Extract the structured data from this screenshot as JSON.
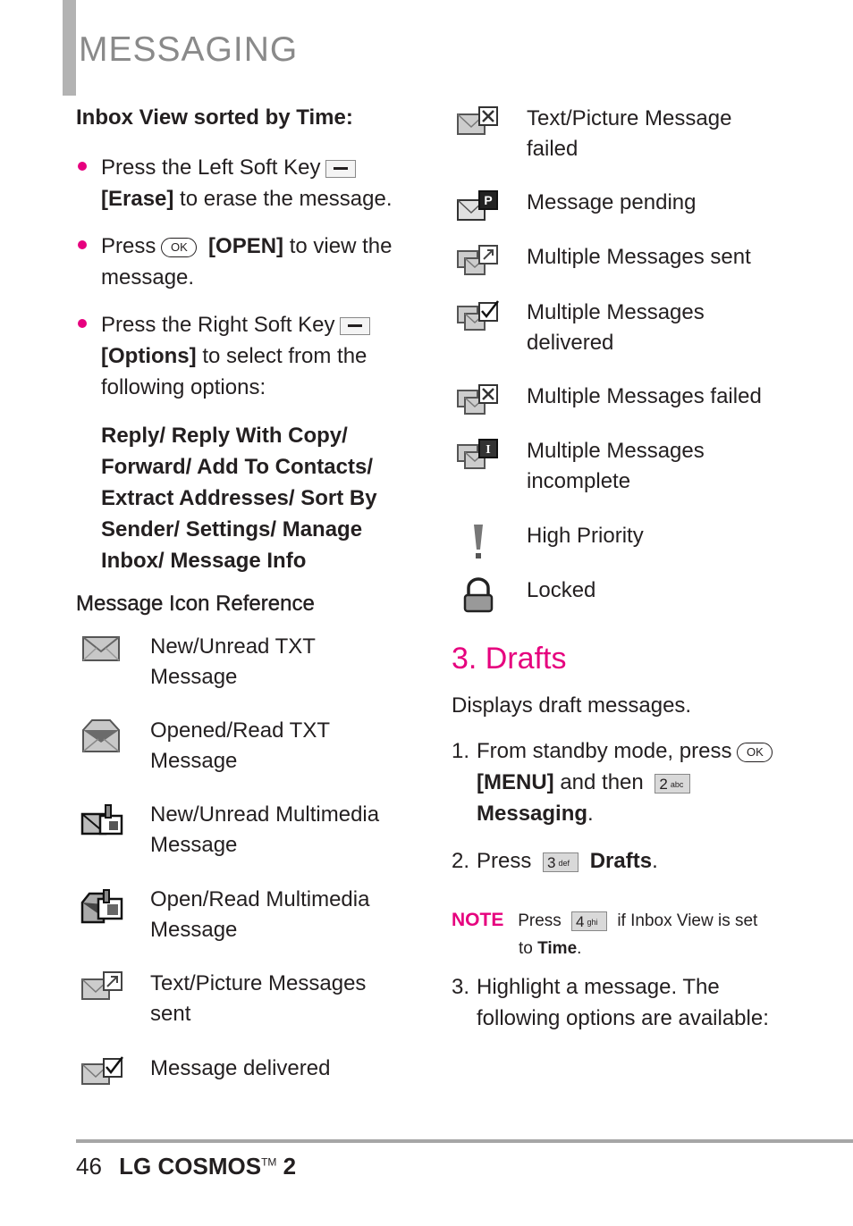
{
  "header": {
    "section_title": "MESSAGING"
  },
  "inbox_view": {
    "heading": "Inbox View sorted by Time:",
    "bullets": [
      {
        "pre": "Press the Left Soft Key",
        "key": "left-soft-key",
        "bold": "[Erase]",
        "post": "to erase the message."
      },
      {
        "pre": "Press",
        "key": "OK",
        "bold": "[OPEN]",
        "post": "to view the message."
      },
      {
        "pre": "Press the Right Soft Key",
        "key": "right-soft-key",
        "bold": "[Options]",
        "post": "to select from the following options:"
      }
    ],
    "options_text": "Reply/ Reply With Copy/ Forward/ Add To Contacts/ Extract Addresses/ Sort By Sender/ Settings/ Manage Inbox/ Message Info"
  },
  "icon_reference": {
    "heading": "Message Icon Reference",
    "left_items": [
      {
        "icon": "envelope-closed-icon",
        "label": "New/Unread TXT\nMessage"
      },
      {
        "icon": "envelope-open-icon",
        "label": "Opened/Read TXT\nMessage"
      },
      {
        "icon": "multimedia-new-icon",
        "label": "New/Unread Multimedia\nMessage"
      },
      {
        "icon": "multimedia-open-icon",
        "label": "Open/Read Multimedia\nMessage"
      },
      {
        "icon": "message-sent-icon",
        "label": "Text/Picture Messages\nsent"
      },
      {
        "icon": "message-delivered-icon",
        "label": "Message delivered"
      }
    ],
    "right_items": [
      {
        "icon": "message-failed-icon",
        "label": "Text/Picture Message\nfailed"
      },
      {
        "icon": "message-pending-icon",
        "label": "Message pending"
      },
      {
        "icon": "multiple-sent-icon",
        "label": "Multiple Messages sent"
      },
      {
        "icon": "multiple-delivered-icon",
        "label": "Multiple Messages\ndelivered"
      },
      {
        "icon": "multiple-failed-icon",
        "label": "Multiple Messages failed"
      },
      {
        "icon": "multiple-incomplete-icon",
        "label": "Multiple Messages\nincomplete"
      },
      {
        "icon": "high-priority-icon",
        "label": "High Priority"
      },
      {
        "icon": "lock-icon",
        "label": "Locked"
      }
    ]
  },
  "drafts": {
    "heading": "3. Drafts",
    "intro": "Displays draft messages.",
    "step1": {
      "num": "1.",
      "pre": "From standby mode, press",
      "key_ok": "OK",
      "bold1": "[MENU]",
      "mid": "and then",
      "key_num": "2",
      "key_sub": "abc",
      "bold2": "Messaging",
      "end": "."
    },
    "step2": {
      "num": "2.",
      "pre": "Press",
      "key_num": "3",
      "key_sub": "def",
      "bold": "Drafts",
      "end": "."
    },
    "note": {
      "label": "NOTE",
      "pre": "Press",
      "key_num": "4",
      "key_sub": "ghi",
      "post": "if Inbox View is set",
      "line2_pre": "to",
      "line2_bold": "Time",
      "end": "."
    },
    "step3": {
      "num": "3.",
      "line1": "Highlight a message. The",
      "line2": "following options are available:"
    }
  },
  "footer": {
    "page_number": "46",
    "brand": "LG COSMOS",
    "tm": "TM",
    "model": "2"
  }
}
